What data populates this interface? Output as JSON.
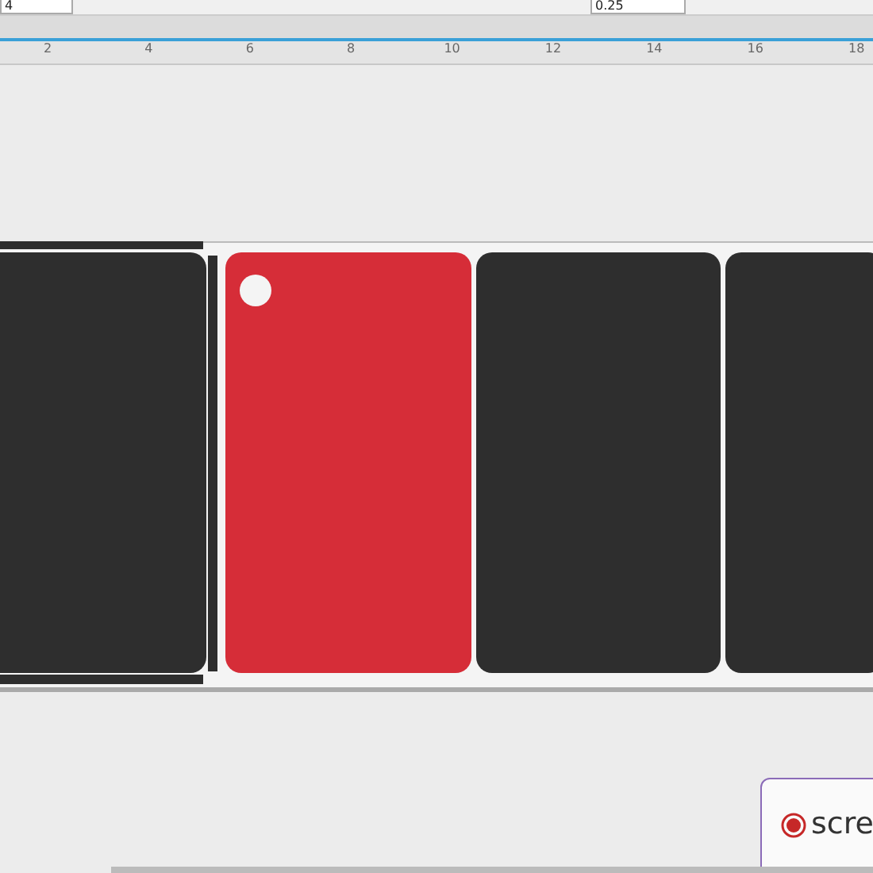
{
  "toolbar": {
    "fields": [
      {
        "value": "4"
      },
      {
        "value": "0.25"
      }
    ]
  },
  "ruler": {
    "labels": [
      "2",
      "4",
      "6",
      "8",
      "10",
      "12",
      "14",
      "16",
      "18"
    ]
  },
  "pieces": [
    {
      "color": "#2e2e2e"
    },
    {
      "color": "#d62d38"
    },
    {
      "color": "#2e2e2e"
    },
    {
      "color": "#2e2e2e"
    }
  ],
  "popup": {
    "title": "scre"
  }
}
